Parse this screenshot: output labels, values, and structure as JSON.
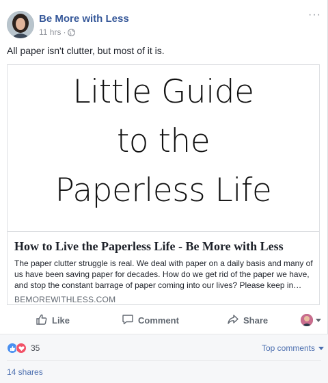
{
  "post": {
    "page_name": "Be More with Less",
    "time": "11 hrs",
    "separator": "·",
    "privacy_icon": "globe-icon",
    "more_label": "···",
    "text": "All paper isn't clutter, but most of it is."
  },
  "attachment": {
    "image_lines": [
      "Little Guide",
      "to the",
      "Paperless Life"
    ],
    "title": "How to Live the Paperless Life - Be More with Less",
    "description": "The paper clutter struggle is real. We deal with paper on a daily basis and many of us have been saving paper for decades. How do we get rid of the paper we have, and stop the constant barrage of paper coming into our lives? Please keep in…",
    "domain": "BEMOREWITHLESS.COM"
  },
  "actions": {
    "like_label": "Like",
    "comment_label": "Comment",
    "share_label": "Share"
  },
  "footer": {
    "reaction_icons": [
      "like-reaction-icon",
      "love-reaction-icon"
    ],
    "reaction_count": "35",
    "sort_label": "Top comments",
    "shares_label": "14 shares"
  },
  "colors": {
    "link_blue": "#365899",
    "meta_gray": "#90949c",
    "like_blue": "#4a90f0",
    "love_red": "#f25268"
  }
}
